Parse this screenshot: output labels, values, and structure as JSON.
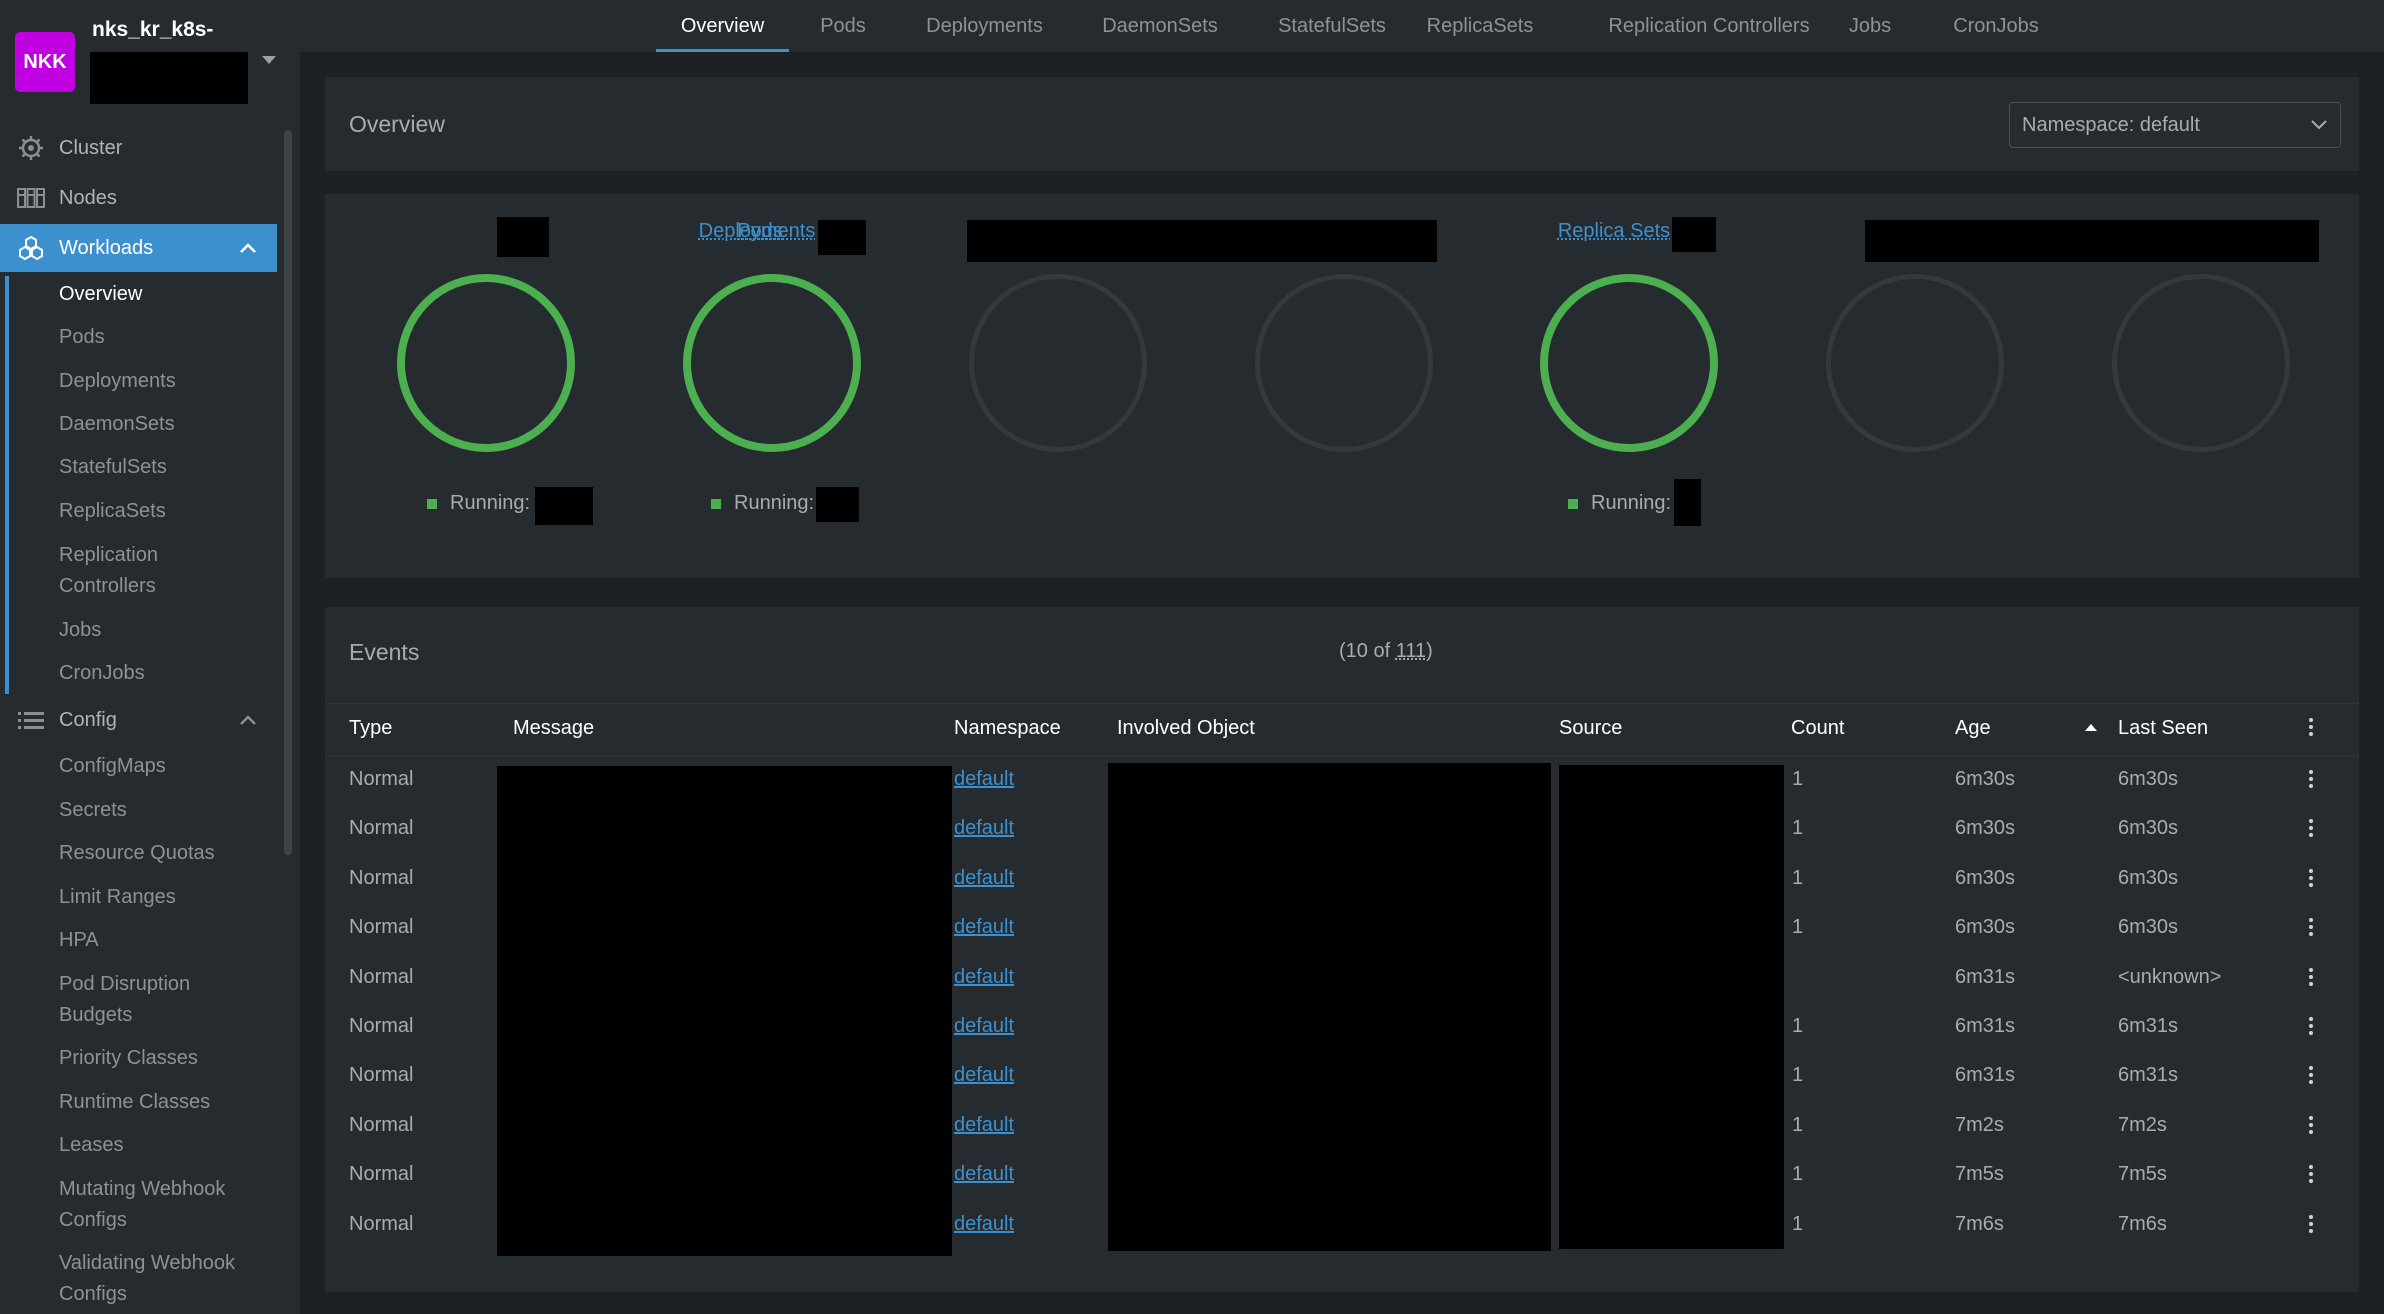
{
  "cluster": {
    "avatar": "NKK",
    "name": "nks_kr_k8s-"
  },
  "sidebar": {
    "cluster": "Cluster",
    "nodes": "Nodes",
    "workloads": "Workloads",
    "workloads_items": [
      "Overview",
      "Pods",
      "Deployments",
      "DaemonSets",
      "StatefulSets",
      "ReplicaSets",
      "Replication",
      "Controllers",
      "Jobs",
      "CronJobs"
    ],
    "config": "Config",
    "config_items": [
      "ConfigMaps",
      "Secrets",
      "Resource Quotas",
      "Limit Ranges",
      "HPA",
      "Pod Disruption",
      "Budgets",
      "Priority Classes",
      "Runtime Classes",
      "Leases",
      "Mutating Webhook",
      "Configs",
      "Validating Webhook",
      "Configs"
    ]
  },
  "tabs": [
    "Overview",
    "Pods",
    "Deployments",
    "DaemonSets",
    "StatefulSets",
    "ReplicaSets",
    "Replication Controllers",
    "Jobs",
    "CronJobs"
  ],
  "overview": {
    "title": "Overview",
    "namespace_select": "Namespace: default",
    "workloads": [
      {
        "label": "Pods",
        "status": "Running:"
      },
      {
        "label": "Deployments",
        "status": "Running:"
      },
      {
        "label": "Replica Sets",
        "status": "Running:"
      }
    ]
  },
  "events": {
    "title": "Events",
    "count_prefix": "(10 of ",
    "count_total": "111",
    "count_suffix": ")",
    "columns": [
      "Type",
      "Message",
      "Namespace",
      "Involved Object",
      "Source",
      "Count",
      "Age",
      "Last Seen"
    ],
    "rows": [
      {
        "type": "Normal",
        "namespace": "default",
        "count": "1",
        "age": "6m30s",
        "last_seen": "6m30s"
      },
      {
        "type": "Normal",
        "namespace": "default",
        "count": "1",
        "age": "6m30s",
        "last_seen": "6m30s"
      },
      {
        "type": "Normal",
        "namespace": "default",
        "count": "1",
        "age": "6m30s",
        "last_seen": "6m30s"
      },
      {
        "type": "Normal",
        "namespace": "default",
        "count": "1",
        "age": "6m30s",
        "last_seen": "6m30s"
      },
      {
        "type": "Normal",
        "namespace": "default",
        "count": "",
        "age": "6m31s",
        "last_seen": "<unknown>"
      },
      {
        "type": "Normal",
        "namespace": "default",
        "count": "1",
        "age": "6m31s",
        "last_seen": "6m31s"
      },
      {
        "type": "Normal",
        "namespace": "default",
        "count": "1",
        "age": "6m31s",
        "last_seen": "6m31s"
      },
      {
        "type": "Normal",
        "namespace": "default",
        "count": "1",
        "age": "7m2s",
        "last_seen": "7m2s"
      },
      {
        "type": "Normal",
        "namespace": "default",
        "count": "1",
        "age": "7m5s",
        "last_seen": "7m5s"
      },
      {
        "type": "Normal",
        "namespace": "default",
        "count": "1",
        "age": "7m6s",
        "last_seen": "7m6s"
      }
    ]
  },
  "colors": {
    "accent": "#3d90ce",
    "running": "#4caf50",
    "avatar": "#c000e0"
  }
}
